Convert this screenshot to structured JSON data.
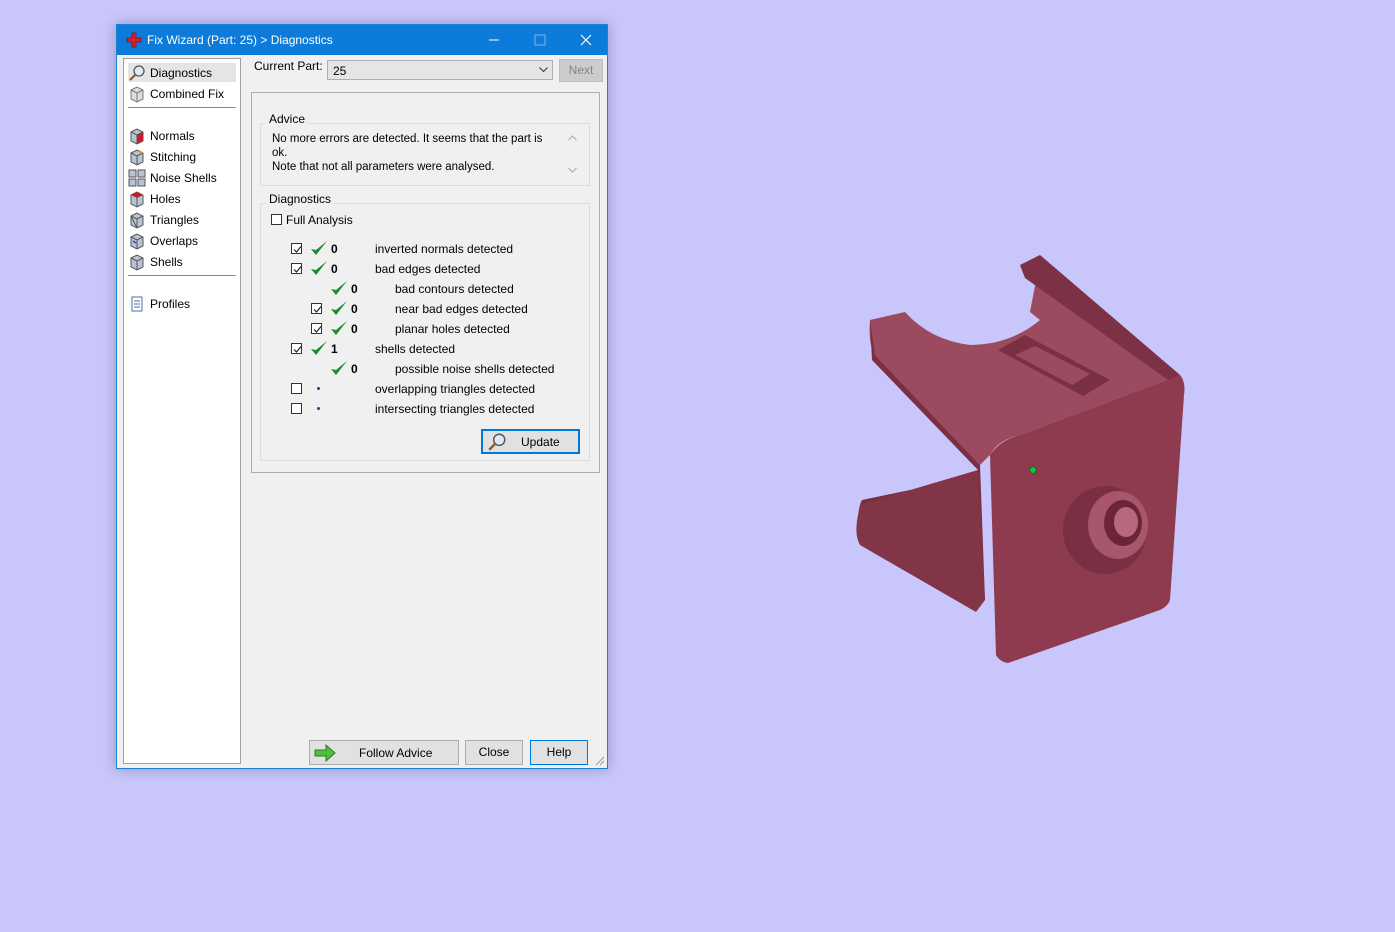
{
  "window": {
    "title": "Fix Wizard (Part: 25) > Diagnostics"
  },
  "sidebar": {
    "items": [
      {
        "label": "Diagnostics",
        "icon": "magnifier-icon",
        "selected": true
      },
      {
        "label": "Combined Fix",
        "icon": "cube-icon"
      },
      {
        "label": "Normals",
        "icon": "normals-cube-icon"
      },
      {
        "label": "Stitching",
        "icon": "stitching-cube-icon"
      },
      {
        "label": "Noise Shells",
        "icon": "noise-shells-icon"
      },
      {
        "label": "Holes",
        "icon": "holes-cube-icon"
      },
      {
        "label": "Triangles",
        "icon": "triangles-cube-icon"
      },
      {
        "label": "Overlaps",
        "icon": "overlaps-cube-icon"
      },
      {
        "label": "Shells",
        "icon": "shells-cube-icon"
      },
      {
        "label": "Profiles",
        "icon": "profiles-document-icon"
      }
    ]
  },
  "current_part": {
    "label": "Current Part:",
    "value": "25",
    "next_label": "Next"
  },
  "advice": {
    "title": "Advice",
    "text": "No more errors are detected. It seems that the part is ok.\nNote that not all parameters were analysed."
  },
  "diagnostics": {
    "title": "Diagnostics",
    "full_analysis_label": "Full Analysis",
    "full_analysis_checked": false,
    "rows": [
      {
        "checkbox": true,
        "checked": true,
        "status": "ok",
        "count": "0",
        "label": "inverted normals detected",
        "indent": 0
      },
      {
        "checkbox": true,
        "checked": true,
        "status": "ok",
        "count": "0",
        "label": "bad edges detected",
        "indent": 0
      },
      {
        "checkbox": false,
        "checked": false,
        "status": "ok",
        "count": "0",
        "label": "bad contours detected",
        "indent": 1
      },
      {
        "checkbox": true,
        "checked": true,
        "status": "ok",
        "count": "0",
        "label": "near bad edges detected",
        "indent": 1
      },
      {
        "checkbox": true,
        "checked": true,
        "status": "ok",
        "count": "0",
        "label": "planar holes detected",
        "indent": 1
      },
      {
        "checkbox": true,
        "checked": true,
        "status": "ok",
        "count": "1",
        "label": "shells detected",
        "indent": 0
      },
      {
        "checkbox": false,
        "checked": false,
        "status": "ok",
        "count": "0",
        "label": "possible noise shells detected",
        "indent": 1
      },
      {
        "checkbox": true,
        "checked": false,
        "status": "not-run",
        "count": "",
        "label": "overlapping triangles detected",
        "indent": 0
      },
      {
        "checkbox": true,
        "checked": false,
        "status": "not-run",
        "count": "",
        "label": "intersecting triangles detected",
        "indent": 0
      }
    ],
    "update_label": "Update"
  },
  "footer": {
    "follow_advice_label": "Follow Advice",
    "close_label": "Close",
    "help_label": "Help"
  },
  "colors": {
    "accent": "#0c7bd9",
    "background": "#c8c6fa",
    "model": "#8e3a4f",
    "ok_tick": "#1e8a2e"
  }
}
